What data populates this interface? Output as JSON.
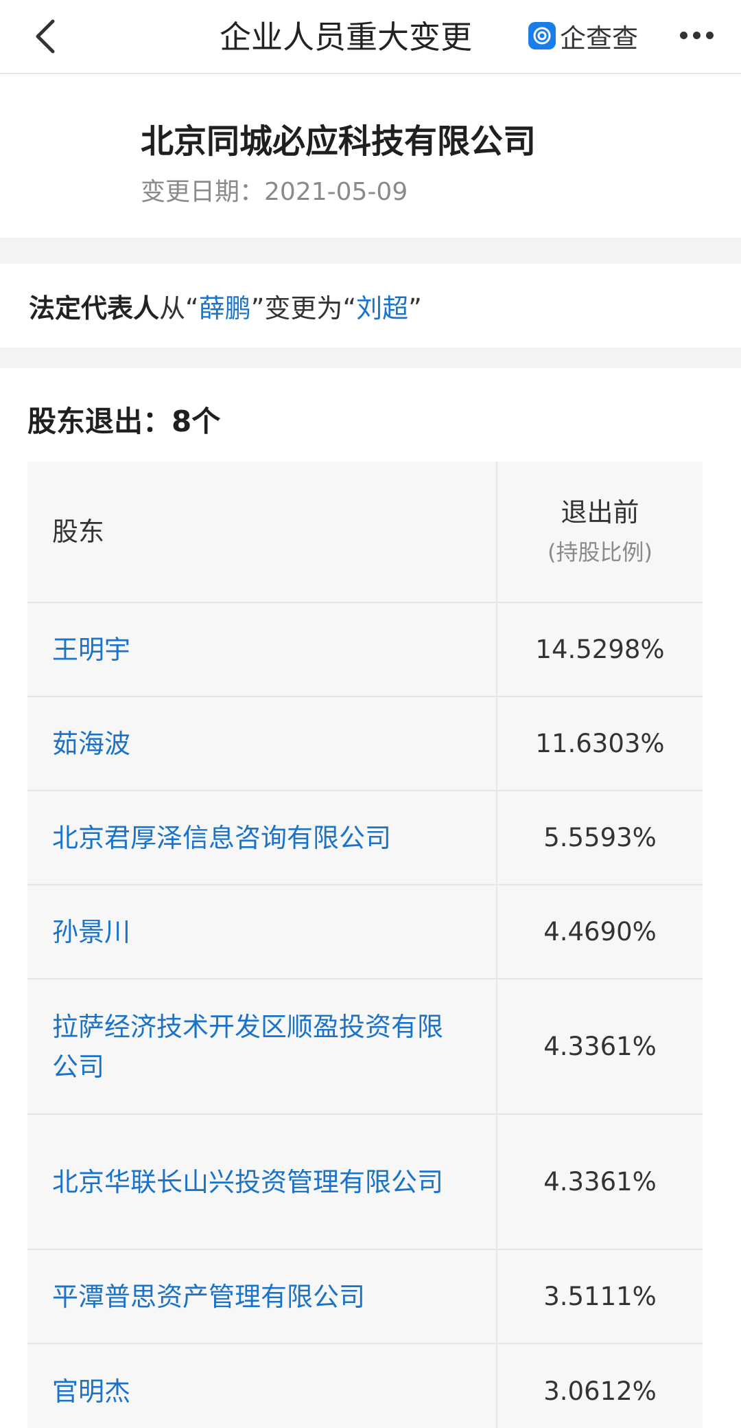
{
  "header": {
    "title": "企业人员重大变更",
    "brand": "企查查"
  },
  "company": {
    "name": "北京同城必应科技有限公司",
    "date_label": "变更日期：",
    "date": "2021-05-09"
  },
  "legal_rep": {
    "label": "法定代表人",
    "from_word": "从",
    "open_quote": "“",
    "close_quote": "”",
    "from_name": "薛鹏",
    "to_word": "变更为",
    "to_name": "刘超"
  },
  "shareholders": {
    "title": "股东退出：8个",
    "col_name": "股东",
    "col_pct": "退出前",
    "col_pct_sub": "(持股比例)",
    "rows": [
      {
        "name": "王明宇",
        "pct": "14.5298%"
      },
      {
        "name": "茹海波",
        "pct": "11.6303%"
      },
      {
        "name": "北京君厚泽信息咨询有限公司",
        "pct": "5.5593%"
      },
      {
        "name": "孙景川",
        "pct": "4.4690%"
      },
      {
        "name": "拉萨经济技术开发区顺盈投资有限公司",
        "pct": "4.3361%"
      },
      {
        "name": "北京华联长山兴投资管理有限公司",
        "pct": "4.3361%"
      },
      {
        "name": "平潭普思资产管理有限公司",
        "pct": "3.5111%"
      },
      {
        "name": "官明杰",
        "pct": "3.0612%"
      }
    ]
  }
}
